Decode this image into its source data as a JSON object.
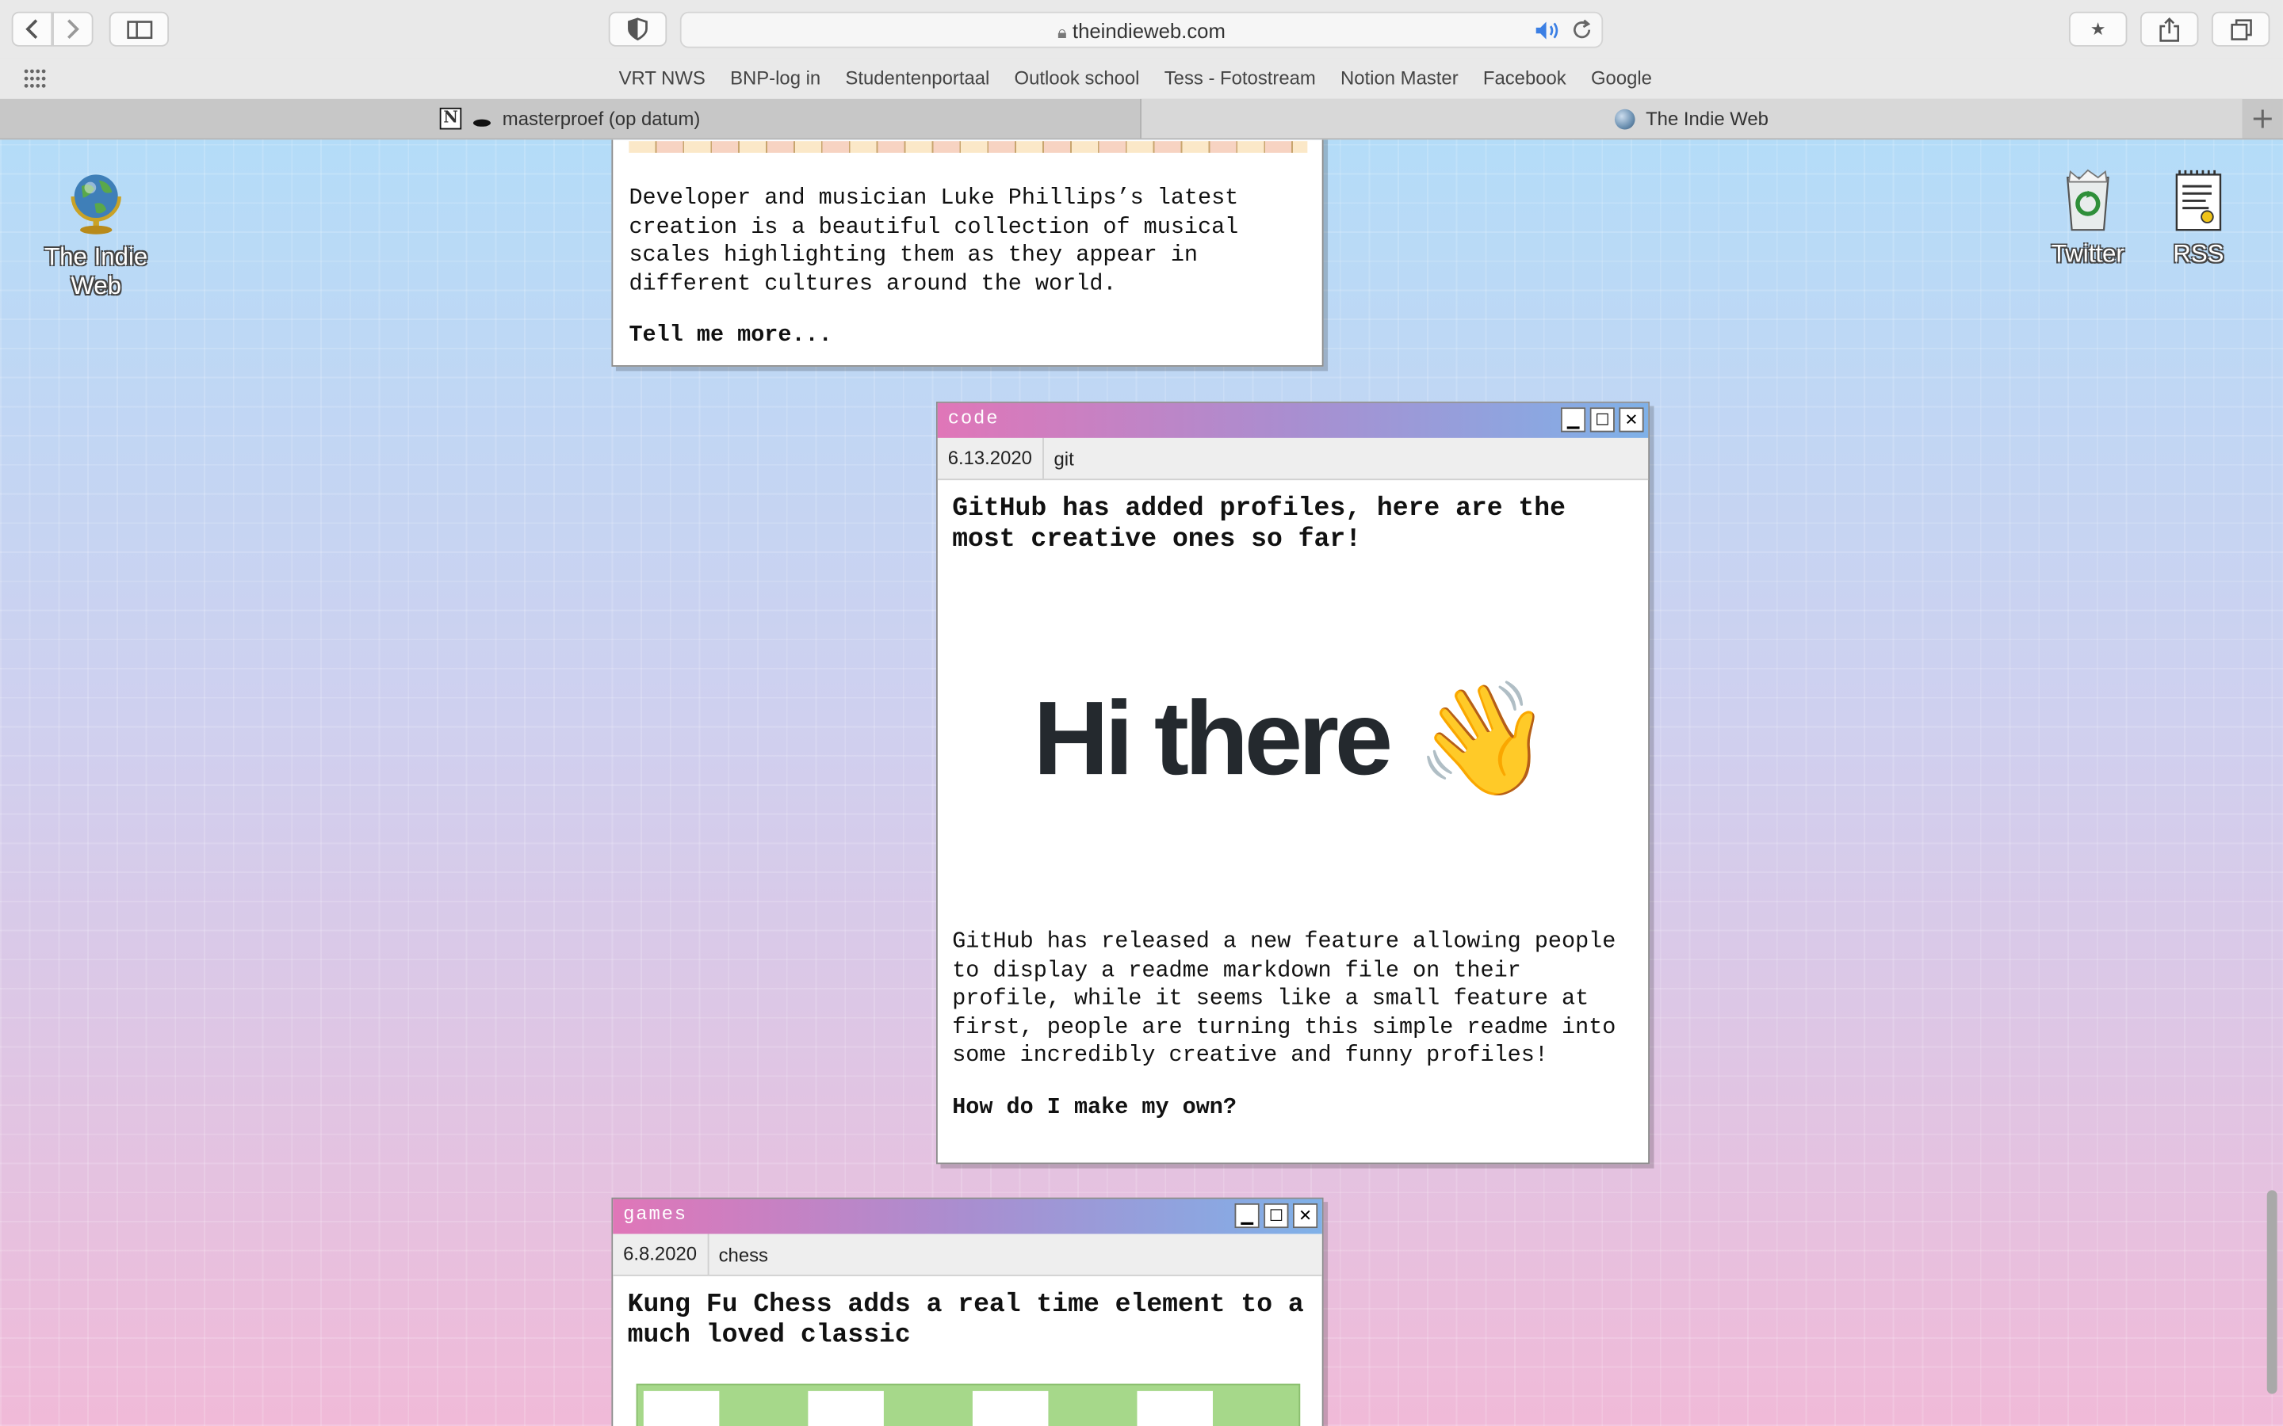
{
  "browser": {
    "url": "theindieweb.com",
    "favorites": [
      "VRT NWS",
      "BNP-log in",
      "Studentenportaal",
      "Outlook school",
      "Tess - Fotostream",
      "Notion Master",
      "Facebook",
      "Google"
    ],
    "tabs": [
      {
        "label": "masterproef (op datum)"
      },
      {
        "label": "The Indie Web"
      }
    ]
  },
  "desktop_icons": {
    "home": "The Indie Web",
    "twitter": "Twitter",
    "rss": "RSS"
  },
  "post_top": {
    "body": "Developer and musician Luke Phillips’s latest creation is a beautiful collection of musical scales highlighting them as they appear in different cultures around the world.",
    "link": "Tell me more..."
  },
  "post_code": {
    "window_title": "code",
    "date": "6.13.2020",
    "category": "git",
    "title": "GitHub has added profiles, here are the most creative ones so far!",
    "image_text": "Hi there",
    "image_emoji": "👋",
    "body": "GitHub has released a new feature allowing people to display a readme markdown file on their profile, while it seems like a small feature at first, people are turning this simple readme into some incredibly creative and funny profiles!",
    "link": "How do I make my own?"
  },
  "post_games": {
    "window_title": "games",
    "date": "6.8.2020",
    "category": "chess",
    "title": "Kung Fu Chess adds a real time element to a much loved classic"
  },
  "colors": {
    "titlebar_start": "#e076b8",
    "titlebar_end": "#7fb1e8",
    "bg_top": "#b4dcf8",
    "bg_bottom": "#f0bad8"
  }
}
